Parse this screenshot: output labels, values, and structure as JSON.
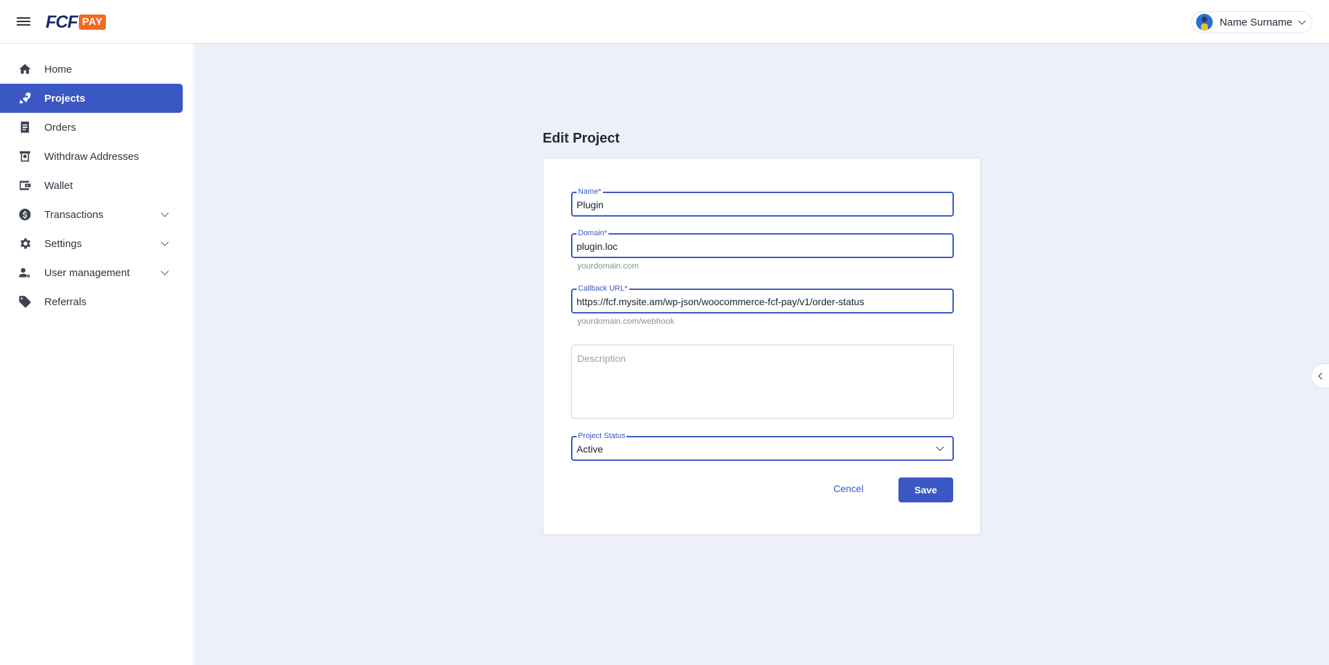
{
  "header": {
    "logo_text": "FCF",
    "logo_badge": "PAY",
    "user_name": "Name Surname"
  },
  "sidebar": {
    "items": [
      {
        "label": "Home",
        "icon": "home-icon"
      },
      {
        "label": "Projects",
        "icon": "rocket-icon",
        "active": true
      },
      {
        "label": "Orders",
        "icon": "receipt-icon"
      },
      {
        "label": "Withdraw Addresses",
        "icon": "withdraw-icon"
      },
      {
        "label": "Wallet",
        "icon": "wallet-icon"
      },
      {
        "label": "Transactions",
        "icon": "dollar-icon",
        "expandable": true
      },
      {
        "label": "Settings",
        "icon": "gear-icon",
        "expandable": true
      },
      {
        "label": "User management",
        "icon": "user-gear-icon",
        "expandable": true
      },
      {
        "label": "Referrals",
        "icon": "tag-icon"
      }
    ]
  },
  "page": {
    "title": "Edit Project"
  },
  "form": {
    "name": {
      "label": "Name*",
      "value": "Plugin"
    },
    "domain": {
      "label": "Domain*",
      "value": "plugin.loc",
      "helper": "yourdomain.com"
    },
    "callback": {
      "label": "Callback URL*",
      "value": "https://fcf.mysite.am/wp-json/woocommerce-fcf-pay/v1/order-status",
      "helper": "yourdomain.com/webhook"
    },
    "description": {
      "placeholder": "Description"
    },
    "status": {
      "label": "Project Status",
      "value": "Active"
    },
    "cancel_label": "Cencel",
    "save_label": "Save"
  },
  "colors": {
    "accent": "#3b57c4",
    "logo_orange": "#f26a21",
    "background": "#edf0f8"
  }
}
